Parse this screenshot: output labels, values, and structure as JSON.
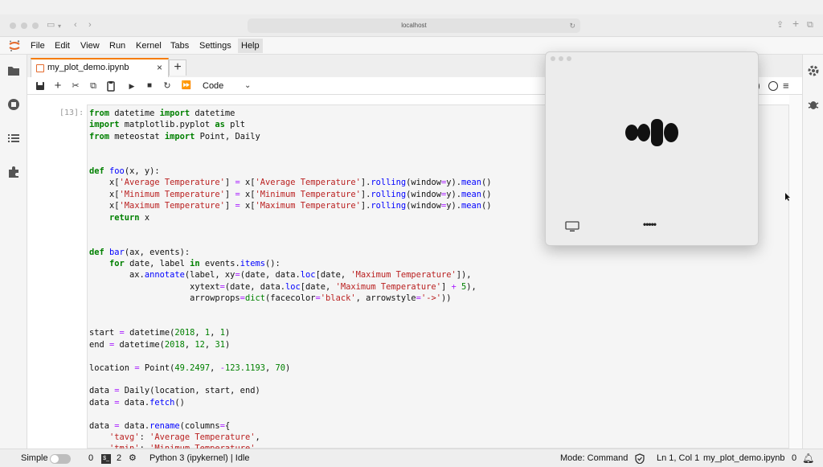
{
  "browser": {
    "address": "localhost"
  },
  "menu": {
    "items": [
      "File",
      "Edit",
      "View",
      "Run",
      "Kernel",
      "Tabs",
      "Settings",
      "Help"
    ],
    "active": "Help"
  },
  "tab": {
    "label": "my_plot_demo.ipynb"
  },
  "toolbar": {
    "cell_type": "Code"
  },
  "cell": {
    "prompt": "[13]:"
  },
  "statusbar": {
    "mode_label": "Simple",
    "terminals": "0",
    "kernels": "2",
    "kernel_status": "Python 3 (ipykernel) | Idle",
    "mode": "Mode: Command",
    "position": "Ln 1, Col 1",
    "filename": "my_plot_demo.ipynb",
    "notifications": "0"
  },
  "overlay": {
    "dots": "•••••"
  },
  "colors": {
    "accent": "#f57c00",
    "keyword": "#008000",
    "string": "#ba2121",
    "function": "#0000ff",
    "operator": "#aa22ff"
  }
}
